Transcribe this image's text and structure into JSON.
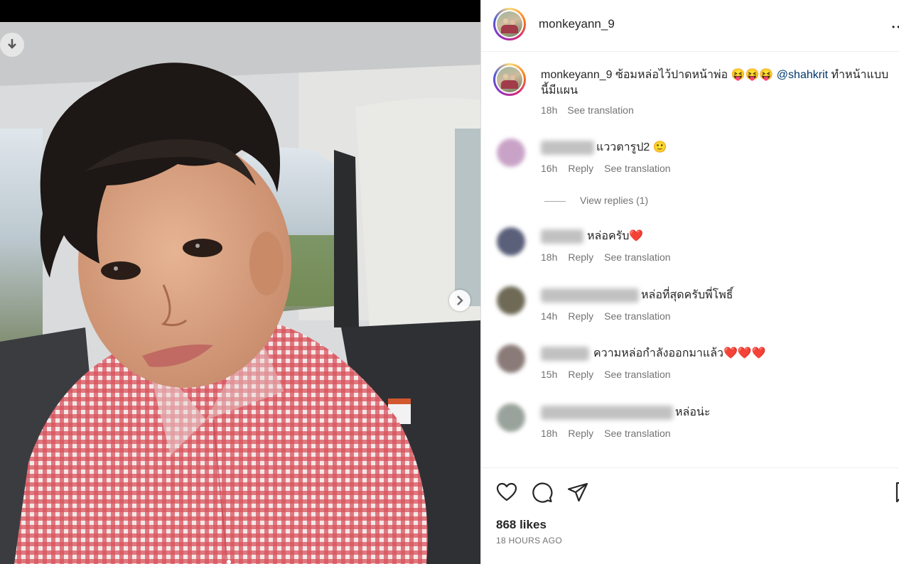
{
  "post": {
    "username": "monkeyann_9",
    "more_icon": "•••",
    "slide_dots": 1
  },
  "caption": {
    "username": "monkeyann_9",
    "text": " ซ้อมหล่อไว้ปาดหน้าพ่อ ",
    "emojis": "😝😝😝",
    "mention": "@shahkrit",
    "text_after": " ทำหน้าแบบนี้มีแผน",
    "time": "18h",
    "see_translation": "See translation"
  },
  "comments": [
    {
      "text": "แววตารูป2 🙂",
      "time": "16h",
      "reply": "Reply",
      "see_translation": "See translation",
      "avatar_color": "#c9a3c7"
    },
    {
      "text": "หล่อครับ❤️",
      "time": "18h",
      "reply": "Reply",
      "see_translation": "See translation",
      "avatar_color": "#5a5f7a"
    },
    {
      "text": "หล่อที่สุดครับพี่โพธิ์",
      "time": "14h",
      "reply": "Reply",
      "see_translation": "See translation",
      "avatar_color": "#6e6a55"
    },
    {
      "text": "ความหล่อกำลังออกมาแล้ว❤️❤️❤️",
      "time": "15h",
      "reply": "Reply",
      "see_translation": "See translation",
      "avatar_color": "#8a7a78"
    },
    {
      "text": "หล่อน่ะ",
      "time": "18h",
      "reply": "Reply",
      "see_translation": "See translation",
      "avatar_color": "#9aa39b"
    }
  ],
  "view_replies": "View replies (1)",
  "actions": {
    "icons": [
      "heart-icon",
      "comment-icon",
      "share-icon",
      "bookmark-icon"
    ],
    "likes": "868 likes",
    "time_ago": "18 HOURS AGO"
  },
  "colors": {
    "text": "#262626",
    "secondary": "#737373",
    "link": "#00376b",
    "heart": "#e0245e"
  }
}
